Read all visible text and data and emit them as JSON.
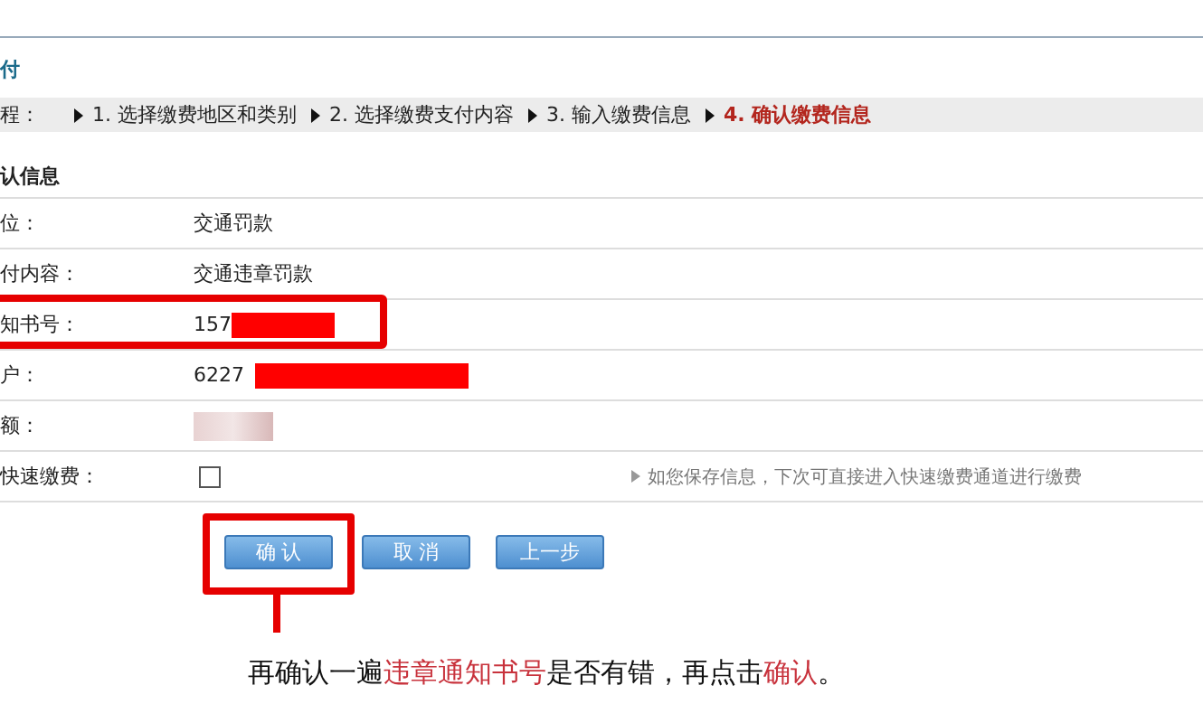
{
  "page_title": "付",
  "steps": {
    "label": "程：",
    "items": [
      {
        "text": "1. 选择缴费地区和类别",
        "selected": false
      },
      {
        "text": "2. 选择缴费支付内容",
        "selected": false
      },
      {
        "text": "3. 输入缴费信息",
        "selected": false
      },
      {
        "text": "4. 确认缴费信息",
        "selected": true
      }
    ]
  },
  "section_title": "认信息",
  "rows": [
    {
      "label": "位：",
      "kind": "text",
      "value": "交通罚款",
      "highlighted": false
    },
    {
      "label": "付内容：",
      "kind": "text",
      "value": "交通违章罚款",
      "highlighted": false
    },
    {
      "label": "知书号：",
      "kind": "redacted",
      "value": "157",
      "highlighted": true
    },
    {
      "label": "户：",
      "kind": "redacted",
      "value": "6227",
      "highlighted": false
    },
    {
      "label": "额：",
      "kind": "blurred",
      "highlighted": false
    },
    {
      "label": "快速缴费：",
      "kind": "checkbox",
      "checked": false,
      "hint": "如您保存信息，下次可直接进入快速缴费通道进行缴费",
      "highlighted": false
    }
  ],
  "buttons": [
    {
      "label": "确 认",
      "highlighted": true
    },
    {
      "label": "取 消",
      "highlighted": false
    },
    {
      "label": "上一步",
      "highlighted": false
    }
  ],
  "annotation": [
    {
      "text": "再确认一遍",
      "highlight": false
    },
    {
      "text": "违章通知书号",
      "highlight": true
    },
    {
      "text": "是否有错，再点击",
      "highlight": false
    },
    {
      "text": "确认",
      "highlight": true
    },
    {
      "text": "。",
      "highlight": false
    }
  ]
}
